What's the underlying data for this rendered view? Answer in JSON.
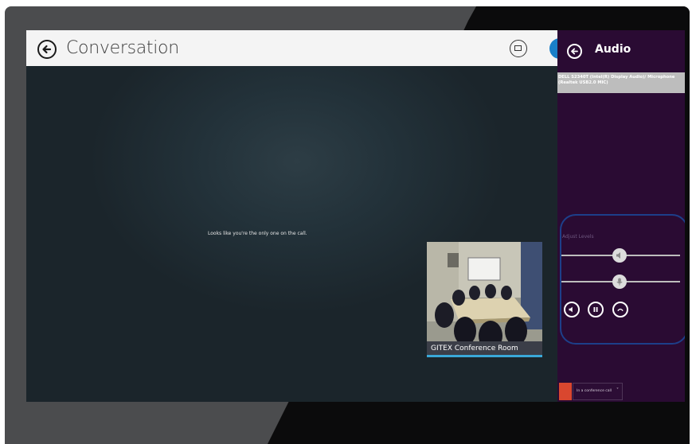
{
  "header": {
    "title": "Conversation"
  },
  "stage": {
    "message": "Looks like you're the only one on the call."
  },
  "video_tile": {
    "caption": "GITEX Conference Room"
  },
  "audio_panel": {
    "title": "Audio",
    "device_text": "DELL S2340T (Intel(R) Display Audio)/ Microphone (Realtek USB2.0 MIC)",
    "levels_label": "Adjust Levels",
    "speaker_level_pct": 50,
    "mic_level_pct": 50,
    "buttons": [
      "speaker-icon",
      "pause-icon",
      "hang-up-icon"
    ]
  },
  "status": {
    "text": "In a conference call",
    "color": "#d9472f"
  },
  "colors": {
    "panel_bg": "#2a0b33",
    "accent_blue": "#1a7fc8",
    "highlight_border": "#1d3f8a"
  }
}
